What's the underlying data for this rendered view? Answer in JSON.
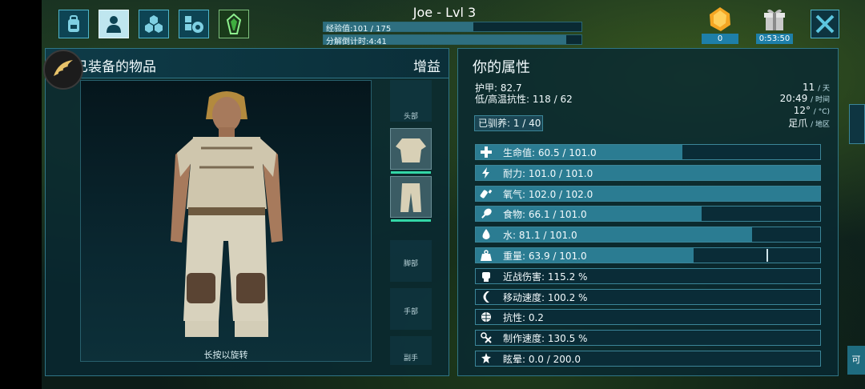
{
  "header": {
    "player_title": "Joe - Lvl 3",
    "xp_text": "经验值:101 / 175",
    "xp_progress": 0.58,
    "decay_text": "分解倒计时:4:41",
    "decay_progress": 0.94
  },
  "tabs": [
    {
      "icon": "backpack-icon"
    },
    {
      "icon": "person-icon"
    },
    {
      "icon": "hex-cluster-icon"
    },
    {
      "icon": "gear-icon"
    },
    {
      "icon": "tek-crystal-icon"
    }
  ],
  "resources": {
    "amber_value": "0",
    "gift_timer": "0:53:50"
  },
  "equipment": {
    "title": "已装备的物品",
    "buff_label": "增益",
    "rotate_hint": "长按以旋转",
    "slots": {
      "head": "头部",
      "feet": "脚部",
      "hands": "手部",
      "offhand": "副手"
    }
  },
  "attributes": {
    "title": "你的属性",
    "armor": "护甲: 82.7",
    "resist": "低/高温抗性: 118 / 62",
    "tamed": "已驯养: 1 / 40",
    "day_num": "11",
    "day_unit": "/ 天",
    "time_num": "20:49",
    "time_unit": "/ 时间",
    "temp_num": "12°",
    "temp_unit": "/ °C)",
    "region_num": "足爪",
    "region_unit": "/ 地区",
    "stats": [
      {
        "icon": "health-cross-icon",
        "text": "生命值: 60.5 / 101.0",
        "fill": 0.6
      },
      {
        "icon": "stamina-bolt-icon",
        "text": "耐力: 101.0 / 101.0",
        "fill": 1.0
      },
      {
        "icon": "oxygen-tank-icon",
        "text": "氧气: 102.0 / 102.0",
        "fill": 1.0
      },
      {
        "icon": "food-drumstick-icon",
        "text": "食物: 66.1 / 101.0",
        "fill": 0.655
      },
      {
        "icon": "water-drop-icon",
        "text": "水: 81.1 / 101.0",
        "fill": 0.803
      },
      {
        "icon": "weight-icon",
        "text": "重量: 63.9 / 101.0",
        "fill": 0.633,
        "marker": 0.844
      },
      {
        "icon": "melee-fist-icon",
        "text": "近战伤害: 115.2 %",
        "fill": 0
      },
      {
        "icon": "speed-icon",
        "text": "移动速度: 100.2 %",
        "fill": 0
      },
      {
        "icon": "fortitude-brain-icon",
        "text": "抗性: 0.2",
        "fill": 0
      },
      {
        "icon": "crafting-tools-icon",
        "text": "制作速度: 130.5 %",
        "fill": 0
      },
      {
        "icon": "torpor-stars-icon",
        "text": "眩晕: 0.0 / 200.0",
        "fill": 0
      }
    ]
  },
  "edge_tab_label": "可",
  "colors": {
    "panel": "#08323c",
    "accent": "#2b7c92",
    "border": "#3b8598"
  }
}
